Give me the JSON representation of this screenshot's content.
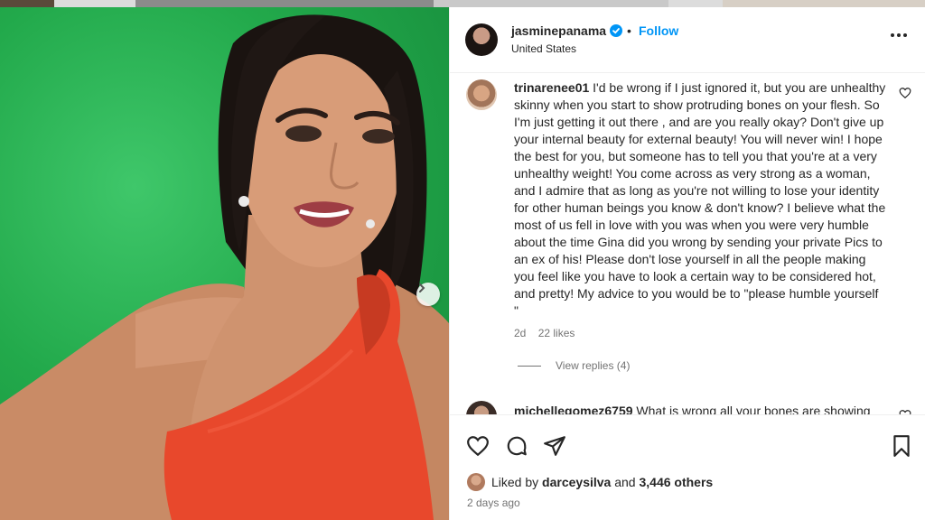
{
  "header": {
    "username": "jasminepanama",
    "follow_label": "Follow",
    "location": "United States",
    "separator": "•"
  },
  "comments": [
    {
      "username": "trinarenee01",
      "text": "I'd be wrong if I just ignored it, but you are unhealthy skinny when you start to show protruding bones on your flesh. So I'm just getting it out there , and are you really okay? Don't give up your internal beauty for external beauty! You will never win! I hope the best for you, but someone has to tell you that you're at a very unhealthy weight! You come across as very strong as a woman, and I admire that as long as you're not willing to lose your identity for other human beings you know & don't know? I believe what the most of us fell in love with you was when you were very humble about the time Gina did you wrong by sending your private Pics to an ex of his! Please don't lose yourself in all the people making you feel like you have to look a certain way to be considered hot, and pretty! My advice to you would be to \"please humble yourself \"",
      "age": "2d",
      "likes": "22 likes",
      "view_replies": "View replies (4)"
    },
    {
      "username": "michellegomez6759",
      "text": "What is wrong all your bones are showing"
    }
  ],
  "footer": {
    "liked_by_prefix": "Liked by",
    "liked_by_user": "darceysilva",
    "liked_and": "and",
    "liked_others": "3,446 others",
    "date": "2 days ago"
  },
  "icons": {
    "verified": "verified-badge-icon",
    "more": "more-options-icon",
    "like": "heart-icon",
    "comment": "comment-icon",
    "share": "share-icon",
    "save": "bookmark-icon",
    "next": "chevron-right-icon"
  },
  "colors": {
    "link": "#0095f6",
    "secondary_text": "#737373",
    "green_screen": "#22a94b",
    "dress": "#e8482c"
  }
}
